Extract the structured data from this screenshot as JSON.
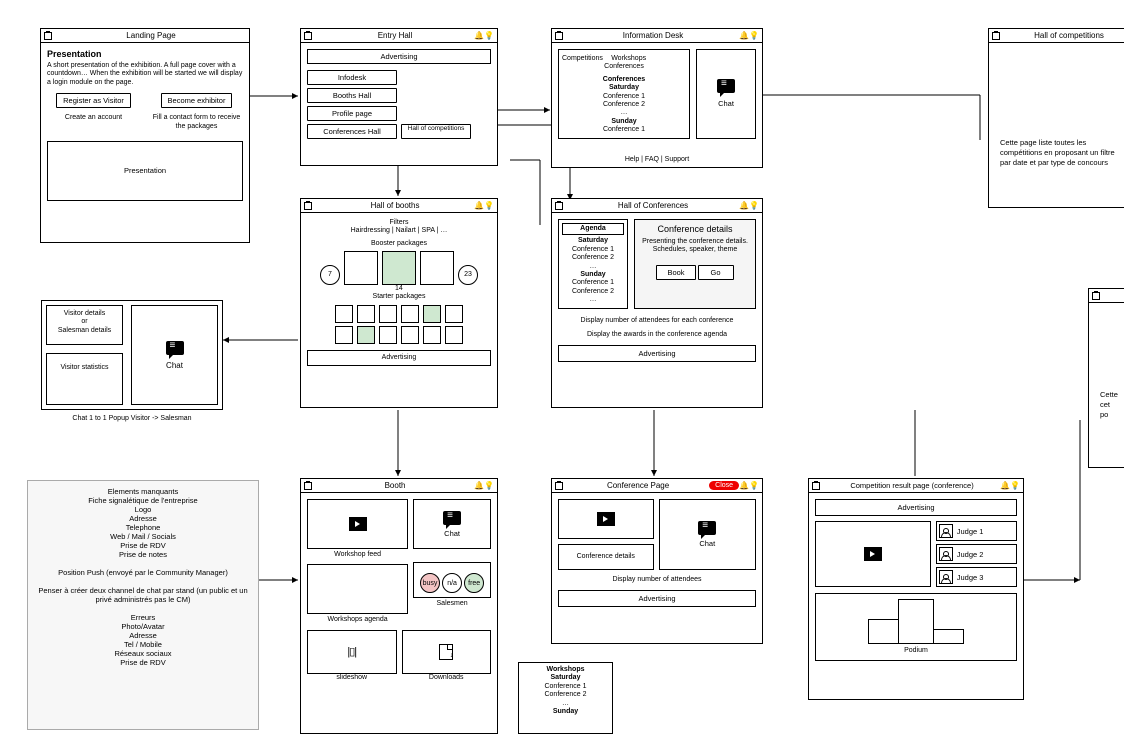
{
  "landing": {
    "title": "Landing Page",
    "heading": "Presentation",
    "desc": "A short presentation of the exhibition. A full page cover with a countdown… When the exhibition will be started we will display a login module on the page.",
    "register_btn": "Register as Visitor",
    "exhibitor_btn": "Become exhibitor",
    "register_sub": "Create an account",
    "exhibitor_sub": "Fill a contact form to receive the packages",
    "pres_label": "Presentation"
  },
  "entry": {
    "title": "Entry Hall",
    "adv": "Advertising",
    "btns": [
      "Infodesk",
      "Booths Hall",
      "Profile page",
      "Conferences Hall"
    ],
    "overflow_btn": "Hall of competitions"
  },
  "info": {
    "title": "Information Desk",
    "tabs": [
      "Competitions",
      "Workshops",
      "Conferences"
    ],
    "conf_hdr": "Conferences",
    "sat": "Saturday",
    "c1": "Conference 1",
    "c2": "Conference 2",
    "sun": "Sunday",
    "footer": "Help | FAQ | Support",
    "chat": "Chat"
  },
  "hoc_note": {
    "title": "Hall of competitions",
    "text": "Cette page liste toutes les compétitions en proposant un filtre par date et par type de concours"
  },
  "popup": {
    "vd": "Visitor details\nor\nSalesman details",
    "vs": "Visitor statistics",
    "chat": "Chat",
    "caption": "Chat 1 to 1 Popup Visitor -> Salesman"
  },
  "hob": {
    "title": "Hall of booths",
    "filters": "Filters",
    "filters_line": "Hairdressing | Nailart | SPA | …",
    "booster": "Booster packages",
    "nums": [
      "7",
      "14",
      "23"
    ],
    "starter": "Starter packages",
    "adv": "Advertising"
  },
  "hconf": {
    "title": "Hall of Conferences",
    "agenda": "Agenda",
    "sat": "Saturday",
    "c1": "Conference 1",
    "c2": "Conference 2",
    "sun": "Sunday",
    "details_hdr": "Conference details",
    "details_txt": "Presenting the conference details.\nSchedules, speaker, theme",
    "book": "Book",
    "go": "Go",
    "note1": "Display number of attendees for each conference",
    "note2": "Display the awards in the conference agenda",
    "adv": "Advertising"
  },
  "far_note": "Cette\ncet\npo",
  "booth": {
    "title": "Booth",
    "feed": "Workshop feed",
    "chat": "Chat",
    "agenda": "Workshops agenda",
    "salesmen": "Salesmen",
    "busy": "busy",
    "na": "n/a",
    "free": "free",
    "slide": "slideshow",
    "dl": "Downloads"
  },
  "ws": {
    "title": "Workshops",
    "sat": "Saturday",
    "c1": "Conference 1",
    "c2": "Conference 2",
    "sun": "Sunday"
  },
  "confpage": {
    "title": "Conference Page",
    "close": "Close",
    "details": "Conference details",
    "chat": "Chat",
    "note": "Display number of attendees",
    "adv": "Advertising"
  },
  "comp_result": {
    "title": "Competition result page (conference)",
    "adv": "Advertising",
    "j1": "Judge 1",
    "j2": "Judge 2",
    "j3": "Judge 3",
    "podium": "Podium"
  },
  "left_note": {
    "l1": "Elements manquants",
    "l2": "Fiche signalétique de l'entreprise",
    "l3": "Logo",
    "l4": "Adresse",
    "l5": "Telephone",
    "l6": "Web / Mail / Socials",
    "l7": "Prise de RDV",
    "l8": "Prise de notes",
    "l9": "Position Push (envoyé par le Community Manager)",
    "l10": "Penser à créer deux channel de chat par stand (un public et un privé administrés pas le CM)",
    "l11": "Erreurs",
    "l12": "Photo/Avatar",
    "l13": "Adresse",
    "l14": "Tel / Mobile",
    "l15": "Réseaux sociaux",
    "l16": "Prise de RDV"
  }
}
